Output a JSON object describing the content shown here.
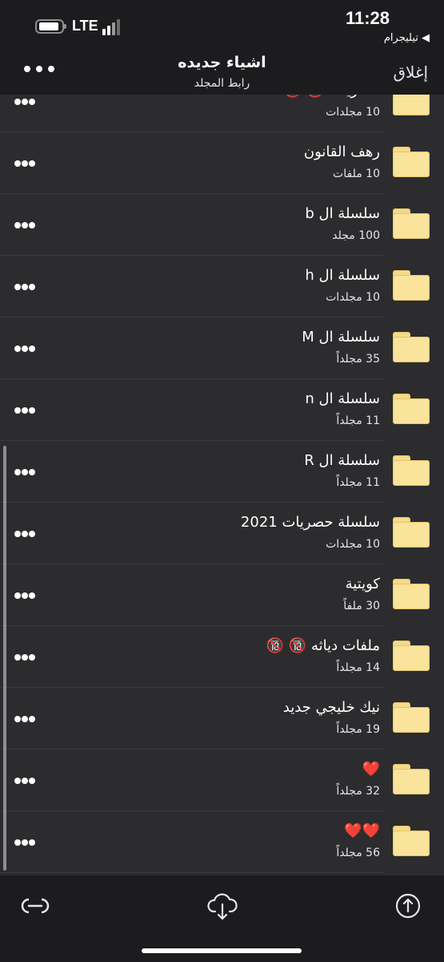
{
  "status_bar": {
    "network": "LTE",
    "time": "11:28",
    "back_app": "◀ تيليجرام"
  },
  "nav": {
    "title": "اشياء جديده",
    "subtitle": "رابط المجلد",
    "close_label": "إغلاق"
  },
  "folders": [
    {
      "name": "حصريات 🔞 🔞",
      "count": "10 مجلدات"
    },
    {
      "name": "رهف القانون",
      "count": "10 ملفات"
    },
    {
      "name": "سلسلة ال b",
      "count": "100 مجلد"
    },
    {
      "name": "سلسلة ال h",
      "count": "10 مجلدات"
    },
    {
      "name": "سلسلة ال M",
      "count": "35 مجلداً"
    },
    {
      "name": "سلسلة ال n",
      "count": "11 مجلداً"
    },
    {
      "name": "سلسلة ال R",
      "count": "11 مجلداً"
    },
    {
      "name": "سلسلة حصريات 2021",
      "count": "10 مجلدات"
    },
    {
      "name": "كويتية",
      "count": "30 ملفاً"
    },
    {
      "name": "ملفات دياثه 🔞 🔞",
      "count": "14 مجلداً"
    },
    {
      "name": "نيك خليجي جديد",
      "count": "19 مجلداً"
    },
    {
      "name": "❤️",
      "count": "32 مجلداً"
    },
    {
      "name": "❤️❤️",
      "count": "56 مجلداً"
    }
  ],
  "icons": {
    "folder": "folder-icon",
    "more": "more-icon",
    "link": "link-icon",
    "download": "cloud-download-icon",
    "share": "share-icon"
  },
  "colors": {
    "background": "#1c1c1e",
    "list_background": "#2c2c2e",
    "folder": "#fae39b"
  }
}
